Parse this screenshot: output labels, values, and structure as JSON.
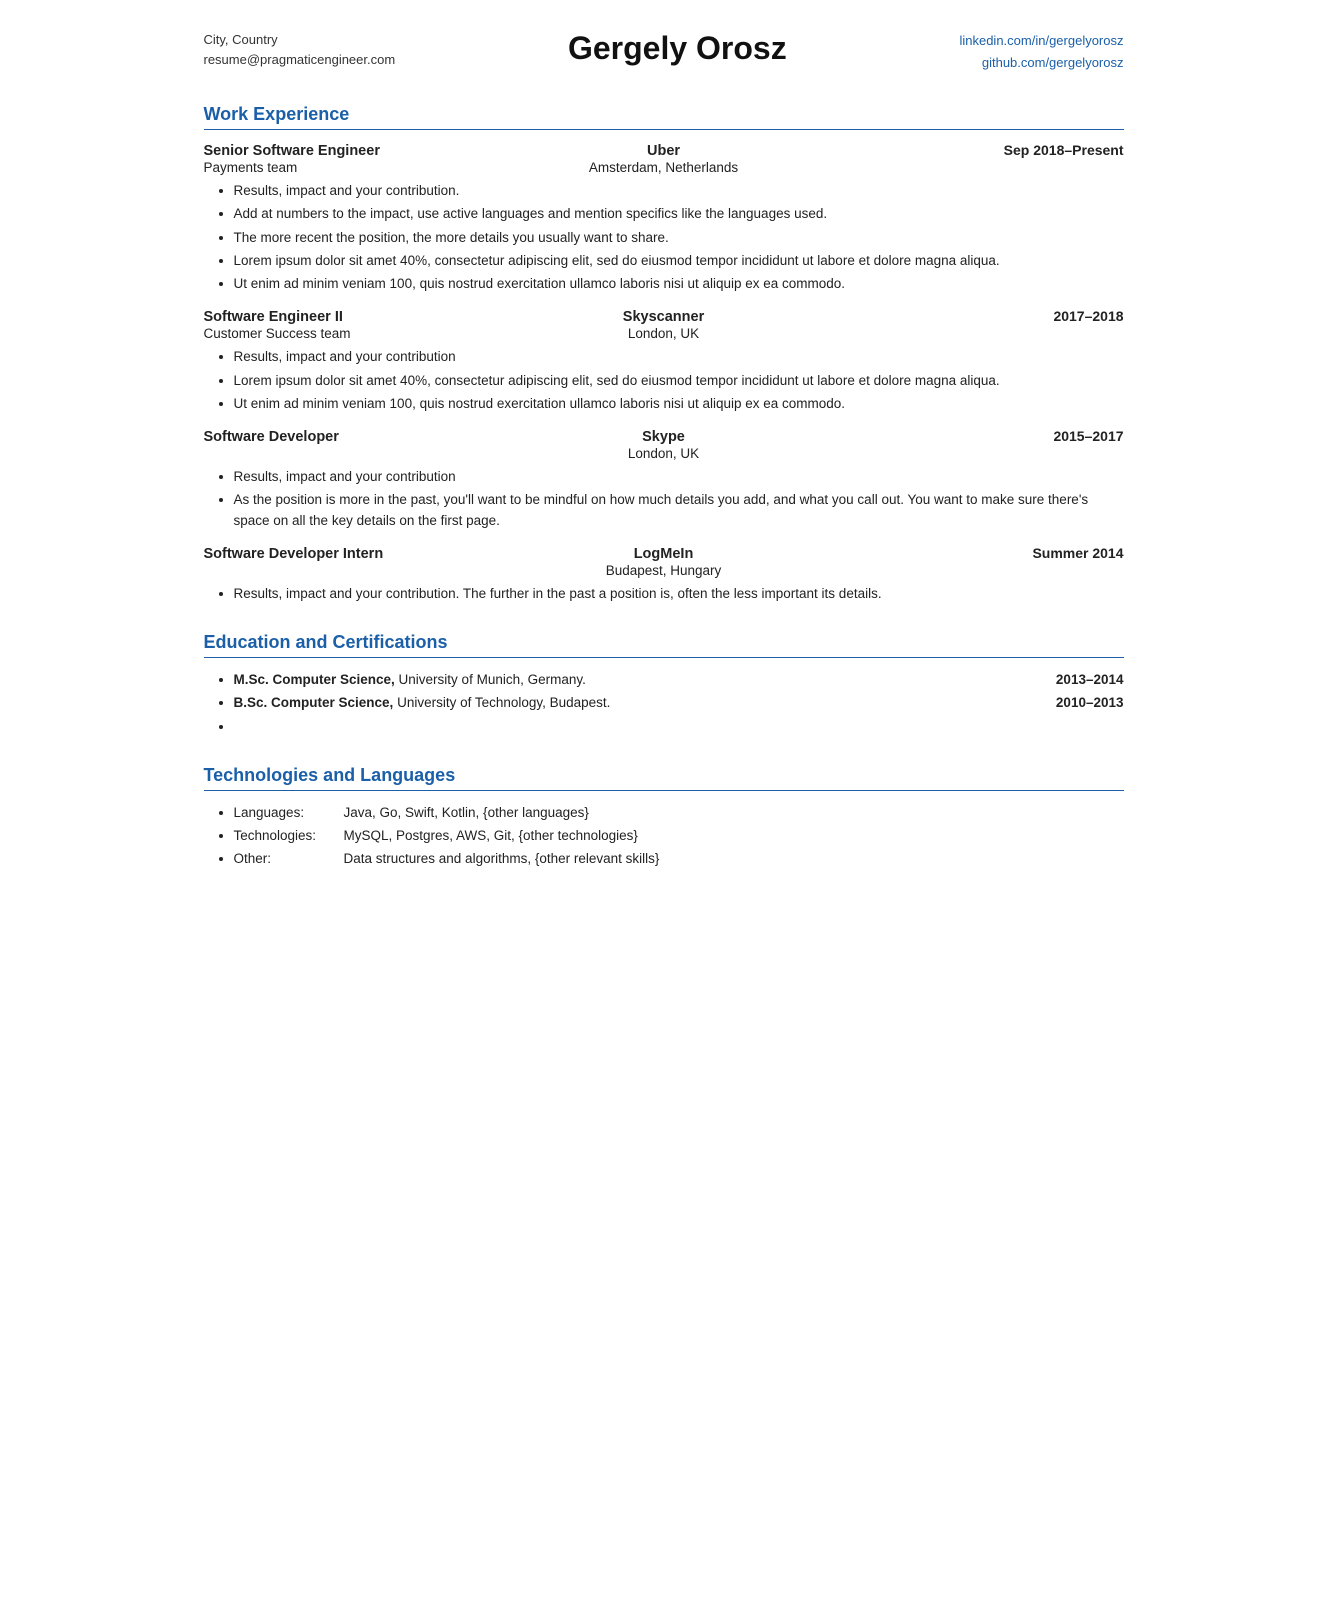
{
  "header": {
    "left_line1": "City, Country",
    "left_line2": "resume@pragmaticengineer.com",
    "name": "Gergely Orosz",
    "right_link1": "linkedin.com/in/gergelyorosz",
    "right_link2": "github.com/gergelyorosz"
  },
  "sections": {
    "work_experience": {
      "title": "Work Experience",
      "jobs": [
        {
          "title": "Senior Software Engineer",
          "company": "Uber",
          "date": "Sep 2018–Present",
          "team": "Payments team",
          "location": "Amsterdam, Netherlands",
          "bullets": [
            "Results, impact and your contribution.",
            "Add at numbers to the impact, use active languages and mention specifics like the languages used.",
            "The more recent the position, the more details you usually want to share.",
            "Lorem ipsum dolor sit amet 40%, consectetur adipiscing elit, sed do eiusmod tempor incididunt ut labore et dolore magna aliqua.",
            "Ut enim ad minim veniam 100, quis nostrud exercitation ullamco laboris nisi ut aliquip ex ea commodo."
          ]
        },
        {
          "title": "Software Engineer II",
          "company": "Skyscanner",
          "date": "2017–2018",
          "team": "Customer Success team",
          "location": "London, UK",
          "bullets": [
            "Results, impact and your contribution",
            "Lorem ipsum dolor sit amet 40%, consectetur adipiscing elit, sed do eiusmod tempor incididunt ut labore et dolore magna aliqua.",
            "Ut enim ad minim veniam 100, quis nostrud exercitation ullamco laboris nisi ut aliquip ex ea commodo."
          ]
        },
        {
          "title": "Software Developer",
          "company": "Skype",
          "date": "2015–2017",
          "team": "",
          "location": "London, UK",
          "bullets": [
            "Results, impact and your contribution",
            "As the position is more in the past, you'll want to be mindful on how much details you add, and what you call out. You want to make sure there's space on all the key details on the first page."
          ]
        },
        {
          "title": "Software Developer Intern",
          "company": "LogMeIn",
          "date": "Summer 2014",
          "team": "",
          "location": "Budapest, Hungary",
          "bullets": [
            "Results, impact and your contribution. The further in the past a position is, often the less important its details."
          ]
        }
      ]
    },
    "education": {
      "title": "Education and Certifications",
      "items": [
        {
          "degree_bold": "M.Sc. Computer Science,",
          "degree_rest": " University of Munich, Germany.",
          "date": "2013–2014"
        },
        {
          "degree_bold": "B.Sc. Computer Science,",
          "degree_rest": " University of Technology, Budapest.",
          "date": "2010–2013"
        },
        {
          "degree_bold": "",
          "degree_rest": "",
          "date": ""
        }
      ]
    },
    "technologies": {
      "title": "Technologies and Languages",
      "items": [
        {
          "label": "Languages:",
          "value": "Java, Go, Swift, Kotlin, {other languages}"
        },
        {
          "label": "Technologies:",
          "value": "MySQL, Postgres, AWS, Git, {other technologies}"
        },
        {
          "label": "Other:",
          "value": "Data structures and algorithms, {other relevant skills}"
        }
      ]
    }
  }
}
